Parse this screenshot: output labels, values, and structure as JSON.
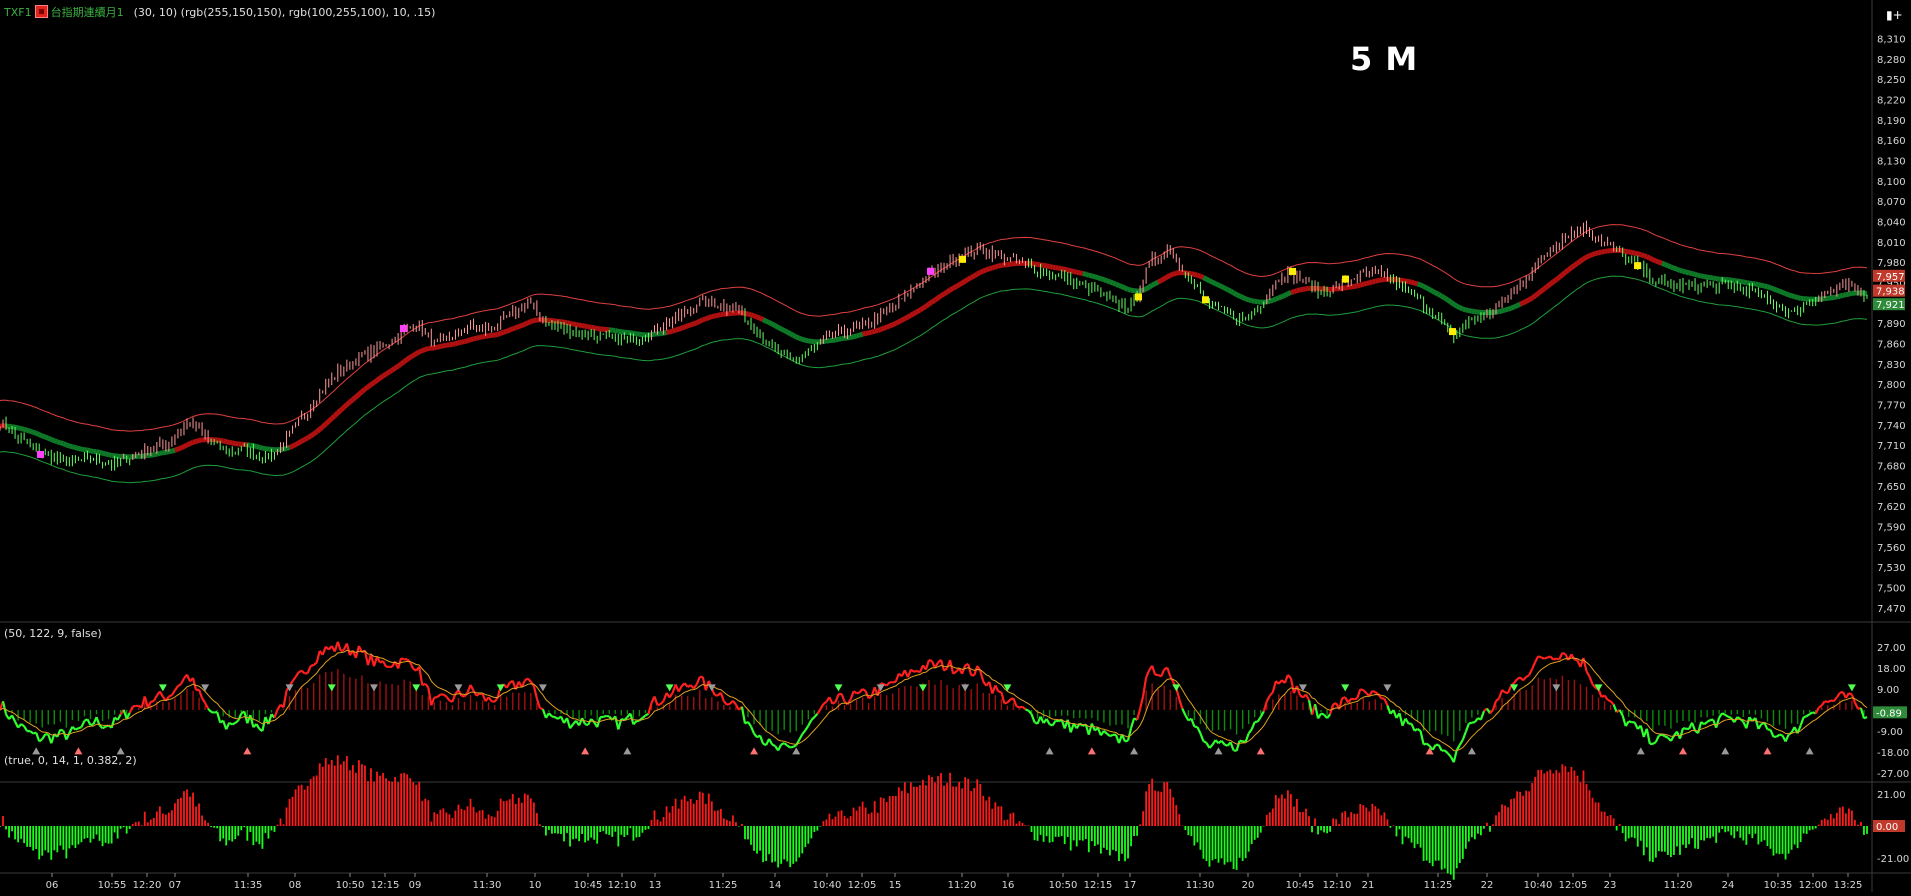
{
  "header": {
    "symbol": "TXF1",
    "name": "台指期連續月1",
    "params": "(30,  10)  (rgb(255,150,150),  rgb(100,255,100),  10,  .15)",
    "timeframe": "5 M",
    "menu_icon": "list-icon"
  },
  "panels": {
    "macd_params": "(50,  122,  9,  false)",
    "hist_params": "(true,  0,  14,  1,  0.382,  2)"
  },
  "colors": {
    "up": "#ff9a9a",
    "down": "#64ff64",
    "band_up": "#e04040",
    "band_dn": "#1e9e3a",
    "hist_up": "#ff1a1a",
    "hist_dn": "#1aff1a",
    "grid": "#3a3a3a"
  },
  "chart_data": [
    {
      "type": "line",
      "name": "price",
      "y_ticks": [
        "8,310",
        "8,280",
        "8,250",
        "8,220",
        "8,190",
        "8,160",
        "8,130",
        "8,100",
        "8,070",
        "8,040",
        "8,010",
        "7,980",
        "7,950",
        "7,920",
        "7,890",
        "7,860",
        "7,830",
        "7,800",
        "7,770",
        "7,740",
        "7,710",
        "7,680",
        "7,650",
        "7,620",
        "7,590",
        "7,560",
        "7,530",
        "7,500",
        "7,470"
      ],
      "ylim": [
        7455,
        8330
      ],
      "last_labels": [
        "7,957",
        "7,938",
        "7,921"
      ],
      "series": [
        {
          "values": [
            7745,
            7720,
            7700,
            7690,
            7685,
            7690,
            7680,
            7695,
            7705,
            7715,
            7745,
            7720,
            7700,
            7705,
            7690,
            7710,
            7750,
            7790,
            7820,
            7840,
            7850,
            7870,
            7890,
            7860,
            7870,
            7885,
            7880,
            7900,
            7920,
            7890,
            7880,
            7875,
            7870,
            7865,
            7870,
            7885,
            7900,
            7920,
            7920,
            7910,
            7885,
            7850,
            7835,
            7850,
            7870,
            7880,
            7890,
            7905,
            7930,
            7955,
            7975,
            7990,
            8000,
            7990,
            7980,
            7970,
            7960,
            7950,
            7940,
            7920,
            7915,
            7980,
            8000,
            7960,
            7920,
            7905,
            7895,
            7925,
            7965,
            7955,
            7935,
            7945,
            7960,
            7965,
            7950,
            7930,
            7905,
            7870,
            7895,
            7905,
            7930,
            7960,
            7995,
            8020,
            8030,
            8010,
            7990,
            7970,
            7950,
            7945,
            7945,
            7945,
            7945,
            7935,
            7920,
            7905,
            7925,
            7935,
            7945,
            7930
          ]
        }
      ]
    },
    {
      "type": "line",
      "name": "oscillator",
      "y_ticks": [
        "27.00",
        "18.00",
        "9.00",
        "0.00",
        "-9.00",
        "-18.00",
        "-27.00"
      ],
      "ylim": [
        -30,
        30
      ],
      "last_labels": [
        "-0.89"
      ]
    },
    {
      "type": "bar",
      "name": "histogram",
      "y_ticks": [
        "21.00",
        "0.00",
        "-21.00"
      ],
      "ylim": [
        -30,
        30
      ],
      "last_labels": [
        "0.00"
      ]
    }
  ],
  "x_axis": {
    "labels": [
      [
        "06",
        52
      ],
      [
        "10:55",
        112
      ],
      [
        "12:20",
        147
      ],
      [
        "07",
        175
      ],
      [
        "11:35",
        248
      ],
      [
        "08",
        295
      ],
      [
        "10:50",
        350
      ],
      [
        "12:15",
        385
      ],
      [
        "09",
        415
      ],
      [
        "11:30",
        487
      ],
      [
        "10",
        535
      ],
      [
        "10:45",
        588
      ],
      [
        "12:10",
        622
      ],
      [
        "13",
        655
      ],
      [
        "11:25",
        723
      ],
      [
        "14",
        775
      ],
      [
        "10:40",
        827
      ],
      [
        "12:05",
        862
      ],
      [
        "15",
        895
      ],
      [
        "11:20",
        962
      ],
      [
        "16",
        1008
      ],
      [
        "10:50",
        1063
      ],
      [
        "12:15",
        1098
      ],
      [
        "17",
        1130
      ],
      [
        "11:30",
        1200
      ],
      [
        "20",
        1248
      ],
      [
        "10:45",
        1300
      ],
      [
        "12:10",
        1337
      ],
      [
        "21",
        1368
      ],
      [
        "11:25",
        1438
      ],
      [
        "22",
        1487
      ],
      [
        "10:40",
        1538
      ],
      [
        "12:05",
        1573
      ],
      [
        "23",
        1610
      ],
      [
        "11:20",
        1678
      ],
      [
        "24",
        1728
      ],
      [
        "10:35",
        1778
      ],
      [
        "12:00",
        1813
      ],
      [
        "13:25",
        1848
      ]
    ]
  }
}
